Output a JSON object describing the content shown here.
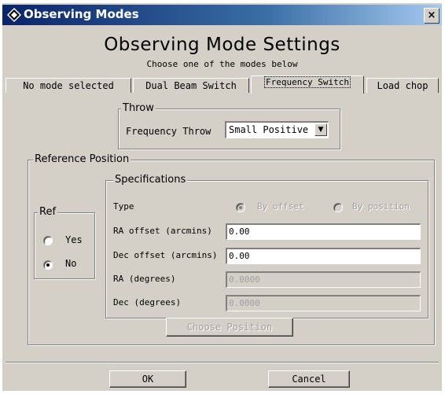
{
  "window": {
    "title": "Observing Modes",
    "close_label": "×"
  },
  "header": {
    "title": "Observing Mode Settings",
    "subtitle": "Choose one of the modes below"
  },
  "tabs": [
    {
      "label": "No mode selected"
    },
    {
      "label": "Dual Beam Switch"
    },
    {
      "label": "Frequency Switch",
      "active": true
    },
    {
      "label": "Load chop"
    }
  ],
  "throw": {
    "legend": "Throw",
    "label": "Frequency Throw",
    "value": "Small Positive"
  },
  "reference": {
    "legend": "Reference Position",
    "ref": {
      "legend": "Ref",
      "options": [
        {
          "label": "Yes",
          "selected": false
        },
        {
          "label": "No",
          "selected": true
        }
      ]
    },
    "specs": {
      "legend": "Specifications",
      "type_label": "Type",
      "type_options": [
        {
          "label": "By offset",
          "selected": true
        },
        {
          "label": "By position",
          "selected": false
        }
      ],
      "ra_offset_label": "RA offset (arcmins)",
      "ra_offset_value": "0.00",
      "dec_offset_label": "Dec offset (arcmins)",
      "dec_offset_value": "0.00",
      "ra_deg_label": "RA (degrees)",
      "ra_deg_value": "0.0000",
      "dec_deg_label": "Dec (degrees)",
      "dec_deg_value": "0.0000"
    },
    "choose_position_label": "Choose Position"
  },
  "footer": {
    "ok_label": "OK",
    "cancel_label": "Cancel"
  }
}
